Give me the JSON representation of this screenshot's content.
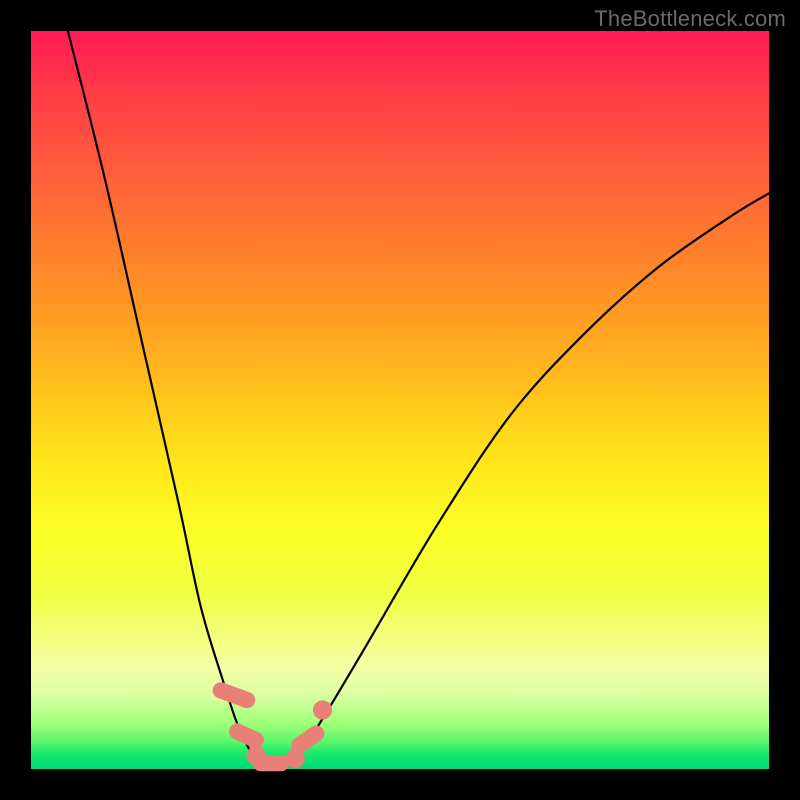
{
  "watermark": "TheBottleneck.com",
  "chart_data": {
    "type": "line",
    "title": "",
    "xlabel": "",
    "ylabel": "",
    "xlim": [
      0,
      100
    ],
    "ylim": [
      0,
      100
    ],
    "grid": false,
    "legend": false,
    "series": [
      {
        "name": "bottleneck-curve",
        "color": "#000000",
        "x": [
          5,
          10,
          15,
          20,
          23,
          26,
          28,
          30,
          32,
          34,
          36,
          39,
          45,
          55,
          65,
          75,
          85,
          95,
          100
        ],
        "y": [
          100,
          80,
          58,
          36,
          22,
          12,
          6,
          2,
          0,
          0,
          2,
          6,
          16,
          33,
          48,
          59,
          68,
          75,
          78
        ]
      }
    ],
    "markers": [
      {
        "shape": "round-rect",
        "x": 27.5,
        "y": 10,
        "w": 2.2,
        "h": 6,
        "angle": -70,
        "color": "#e98077"
      },
      {
        "shape": "round-rect",
        "x": 29.2,
        "y": 4.5,
        "w": 2.2,
        "h": 5,
        "angle": -65,
        "color": "#e98077"
      },
      {
        "shape": "circle",
        "x": 30.5,
        "y": 1.8,
        "r": 1.3,
        "color": "#e98077"
      },
      {
        "shape": "round-rect",
        "x": 32.5,
        "y": 0.8,
        "w": 5,
        "h": 2.2,
        "angle": 0,
        "color": "#e98077"
      },
      {
        "shape": "circle",
        "x": 35.8,
        "y": 1.4,
        "r": 1.3,
        "color": "#e98077"
      },
      {
        "shape": "round-rect",
        "x": 37.5,
        "y": 4.0,
        "w": 2.2,
        "h": 5,
        "angle": 55,
        "color": "#e98077"
      },
      {
        "shape": "circle",
        "x": 39.5,
        "y": 8.0,
        "r": 1.3,
        "color": "#e98077"
      }
    ],
    "background_gradient": {
      "stops": [
        {
          "pos": 0,
          "color": "#ff1a55"
        },
        {
          "pos": 0.5,
          "color": "#ffd21a"
        },
        {
          "pos": 0.85,
          "color": "#f3ff90"
        },
        {
          "pos": 1.0,
          "color": "#00da6f"
        }
      ]
    }
  }
}
